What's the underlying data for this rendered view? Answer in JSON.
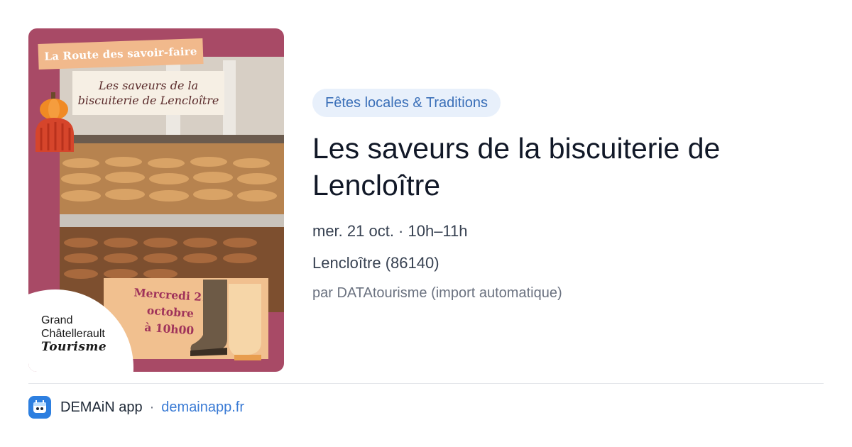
{
  "poster": {
    "route_banner": "La Route des savoir-faire",
    "title_line1": "Les saveurs de la",
    "title_line2": "biscuiterie de Lencloître",
    "date_line1": "Mercredi 21",
    "date_line2": "octobre",
    "date_line3": "à 10h00",
    "logo_line1": "Grand",
    "logo_line2": "Châtellerault",
    "logo_line3": "Tourisme",
    "bg_color": "#a84a66"
  },
  "event": {
    "category": "Fêtes locales & Traditions",
    "title": "Les saveurs de la biscuiterie de Lencloître",
    "datetime": "mer. 21 oct. · 10h–11h",
    "location": "Lencloître (86140)",
    "source": "par DATAtourisme (import automatique)"
  },
  "footer": {
    "app_icon": "demain-app-icon",
    "app_name": "DEMAiN app",
    "separator": "·",
    "link": "demainapp.fr"
  },
  "colors": {
    "accent": "#3a7bd5",
    "chip_bg": "#e8f0fb",
    "chip_text": "#3a6fb8"
  }
}
